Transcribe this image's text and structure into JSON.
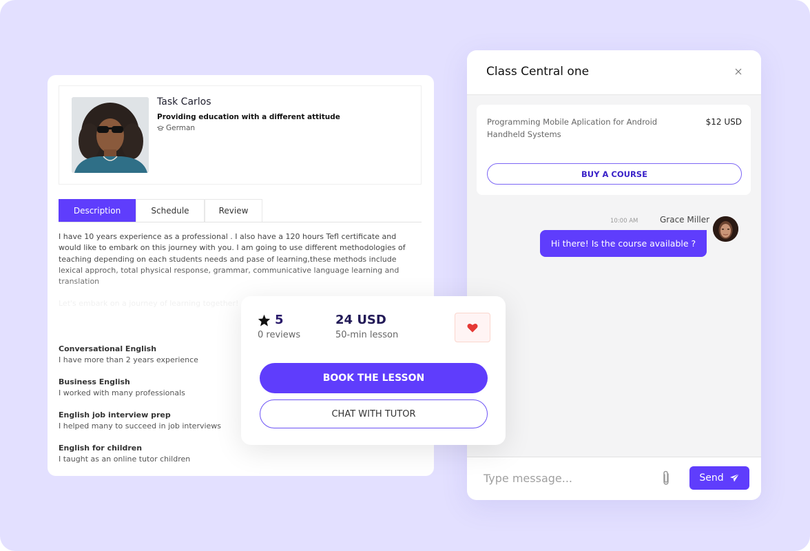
{
  "tutor": {
    "name": "Task Carlos",
    "tagline": "Providing education with a different attitude",
    "language": "German",
    "language_icon": "graduation-cap-icon"
  },
  "tabs": [
    {
      "label": "Description",
      "active": true
    },
    {
      "label": "Schedule",
      "active": false
    },
    {
      "label": "Review",
      "active": false
    }
  ],
  "description": {
    "paragraph": "I have 10 years experience as a professional . I also have a 120 hours Tefl certificate and would like to embark on this journey with you. I am going to use different methodologies of teaching depending on each students needs and pase of learning,these methods include lexical approch, total physical response, grammar, communicative language learning and translation",
    "faded_line": "Let's embark on a journey of learning together!"
  },
  "skills": [
    {
      "title": "Conversational English",
      "text": "I have more than 2 years experience"
    },
    {
      "title": "Business English",
      "text": "I worked with many professionals"
    },
    {
      "title": "English job interview prep",
      "text": "I helped many to succeed in job interviews"
    },
    {
      "title": "English for children",
      "text": "I taught as an online tutor children"
    }
  ],
  "booking": {
    "rating": "5",
    "reviews": "0 reviews",
    "price": "24 USD",
    "price_sub": "50-min lesson",
    "favorite_icon": "heart-icon",
    "book_label": "BOOK THE LESSON",
    "chat_label": "CHAT WITH TUTOR"
  },
  "chat": {
    "title": "Class Central one",
    "close_icon": "close-icon",
    "course": {
      "name": "Programming Mobile Aplication for Android Handheld Systems",
      "price": "$12 USD",
      "buy_label": "BUY A COURSE"
    },
    "messages": [
      {
        "time": "10:00 AM",
        "sender": "Grace Miller",
        "text": "Hi there! Is the course available ?"
      }
    ],
    "input_placeholder": "Type message...",
    "input_value": "",
    "send_label": "Send"
  },
  "colors": {
    "accent": "#5f3dfc",
    "background": "#e3e0ff",
    "heart": "#e53935"
  }
}
